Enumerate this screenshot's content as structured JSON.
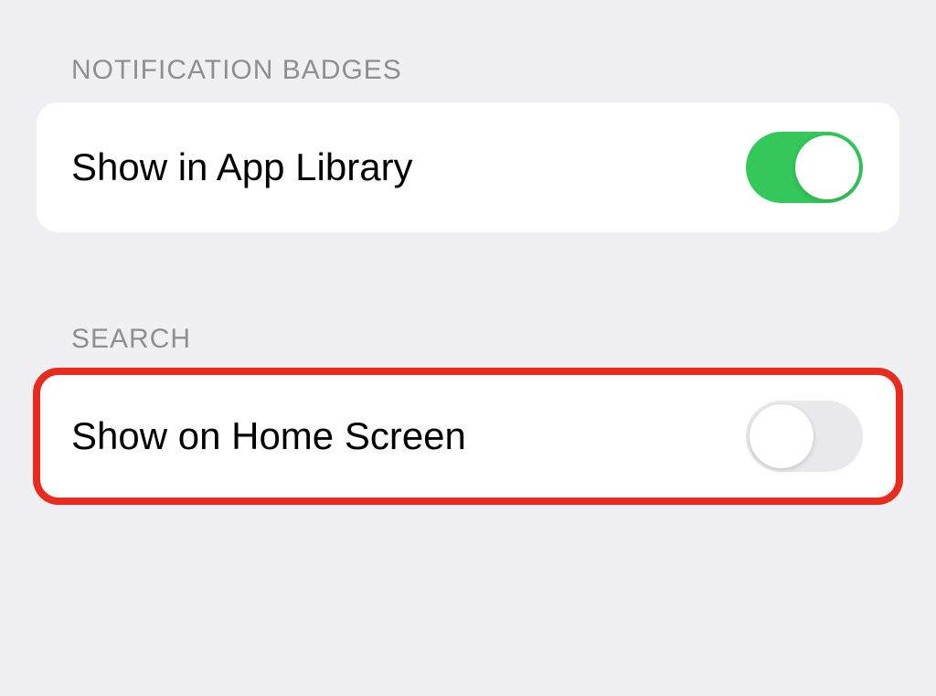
{
  "sections": {
    "notification_badges": {
      "header": "NOTIFICATION BADGES",
      "items": {
        "app_library": {
          "label": "Show in App Library",
          "enabled": true
        }
      }
    },
    "search": {
      "header": "SEARCH",
      "items": {
        "home_screen": {
          "label": "Show on Home Screen",
          "enabled": false
        }
      }
    }
  },
  "highlight": {
    "target": "search.home_screen",
    "color": "#e92b1f"
  },
  "colors": {
    "toggle_on": "#34c759",
    "toggle_off": "#e9e9eb",
    "background": "#f0f0f2",
    "header_text": "#8e8e93"
  }
}
